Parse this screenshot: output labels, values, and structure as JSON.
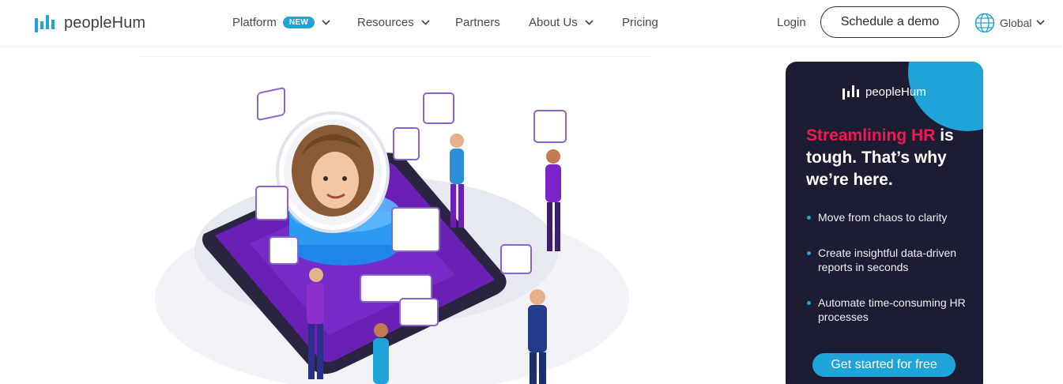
{
  "header": {
    "logo_text": "peopleHum",
    "nav": [
      {
        "label": "Platform",
        "badge": "NEW"
      },
      {
        "label": "Resources"
      },
      {
        "label": "Partners"
      },
      {
        "label": "About Us"
      },
      {
        "label": "Pricing"
      }
    ],
    "login_label": "Login",
    "demo_label": "Schedule a demo",
    "region_label": "Global"
  },
  "colors": {
    "accent_blue": "#1fa3d8",
    "promo_bg": "#1c1d33",
    "promo_accent": "#f0194f",
    "illustration_purple": "#6a1fb5"
  },
  "promo": {
    "logo_text": "peopleHum",
    "heading_accent": "Streamlining HR",
    "heading_rest": " is tough. That’s why we’re here.",
    "bullets": [
      "Move from chaos to clarity",
      "Create insightful data-driven reports in seconds",
      "Automate time-consuming HR processes"
    ],
    "cta_label": "Get started for free"
  }
}
